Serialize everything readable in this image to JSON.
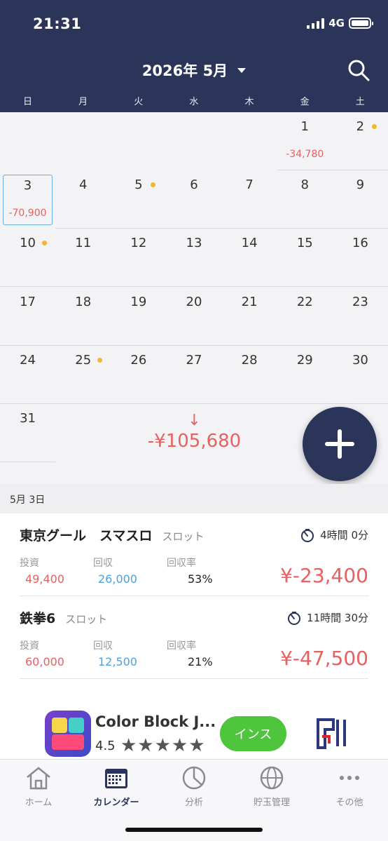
{
  "status": {
    "time": "21:31",
    "network": "4G"
  },
  "header": {
    "month_title": "2026年 5月"
  },
  "weekdays": [
    "日",
    "月",
    "火",
    "水",
    "木",
    "金",
    "土"
  ],
  "calendar": {
    "days": [
      {
        "day": "1",
        "amount": "-34,780"
      },
      {
        "day": "2",
        "dot": true
      },
      {
        "day": "3",
        "amount": "-70,900",
        "selected": true
      },
      {
        "day": "4"
      },
      {
        "day": "5",
        "dot": true
      },
      {
        "day": "6"
      },
      {
        "day": "7"
      },
      {
        "day": "8"
      },
      {
        "day": "9"
      },
      {
        "day": "10",
        "dot": true
      },
      {
        "day": "11"
      },
      {
        "day": "12"
      },
      {
        "day": "13"
      },
      {
        "day": "14"
      },
      {
        "day": "15"
      },
      {
        "day": "16"
      },
      {
        "day": "17"
      },
      {
        "day": "18"
      },
      {
        "day": "19"
      },
      {
        "day": "20"
      },
      {
        "day": "21"
      },
      {
        "day": "22"
      },
      {
        "day": "23"
      },
      {
        "day": "24"
      },
      {
        "day": "25",
        "dot": true
      },
      {
        "day": "26"
      },
      {
        "day": "27"
      },
      {
        "day": "28"
      },
      {
        "day": "29"
      },
      {
        "day": "30"
      },
      {
        "day": "31"
      }
    ],
    "month_total": "-¥105,680",
    "total_arrow": "↓"
  },
  "selected_date": {
    "label": "5月 3日"
  },
  "entries": [
    {
      "name": "東京グール　スマスロ",
      "category": "スロット",
      "duration": "4時間 0分",
      "invest_label": "投資",
      "invest": "49,400",
      "return_label": "回収",
      "return": "26,000",
      "rate_label": "回収率",
      "rate": "53%",
      "result": "¥-23,400"
    },
    {
      "name": "鉄拳6",
      "category": "スロット",
      "duration": "11時間 30分",
      "invest_label": "投資",
      "invest": "60,000",
      "return_label": "回収",
      "return": "12,500",
      "rate_label": "回収率",
      "rate": "21%",
      "result": "¥-47,500"
    }
  ],
  "ad": {
    "title": "Color Block J...",
    "rating": "4.5",
    "stars": "★★★★★",
    "install_label": "インス"
  },
  "tabbar": {
    "items": [
      {
        "label": "ホーム",
        "icon": "home-icon"
      },
      {
        "label": "カレンダー",
        "icon": "calendar-icon",
        "active": true
      },
      {
        "label": "分析",
        "icon": "pie-chart-icon"
      },
      {
        "label": "貯玉管理",
        "icon": "globe-icon"
      },
      {
        "label": "その他",
        "icon": "more-icon"
      }
    ]
  },
  "colors": {
    "header_bg": "#2b3559",
    "loss_red": "#e96060",
    "return_blue": "#4aa3df",
    "dot_yellow": "#f5b62c"
  }
}
